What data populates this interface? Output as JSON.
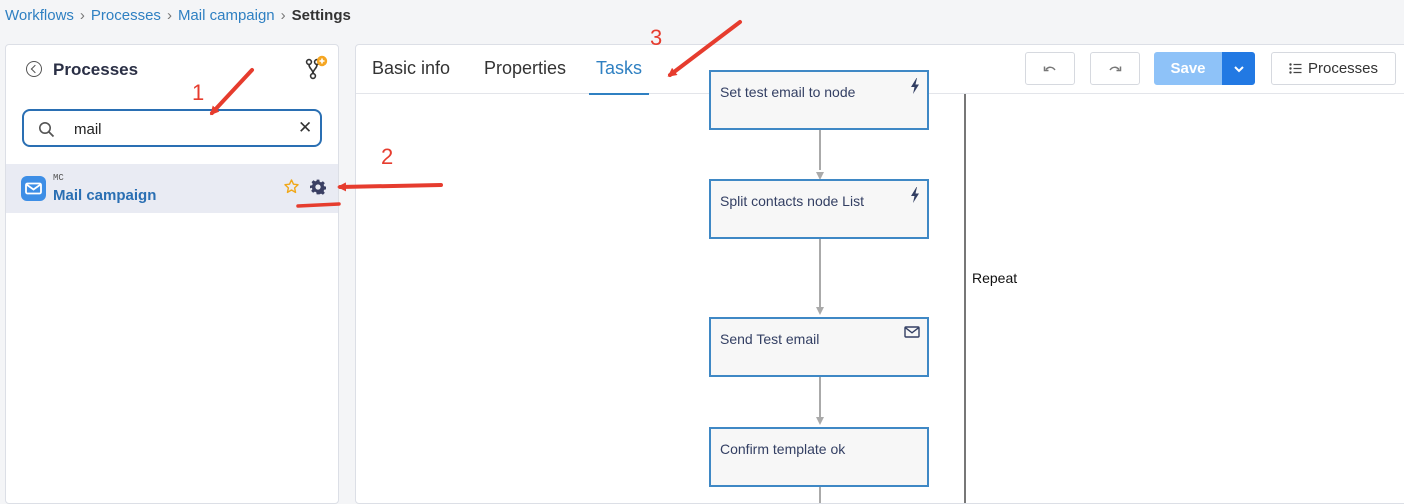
{
  "breadcrumb": {
    "item1": "Workflows",
    "item2": "Processes",
    "item3": "Mail campaign",
    "current": "Settings",
    "separator": "›"
  },
  "sidebar": {
    "title": "Processes",
    "search": {
      "value": "mail",
      "placeholder": ""
    },
    "items": [
      {
        "code": "MC",
        "name": "Mail campaign",
        "favorite": false
      }
    ]
  },
  "tabs": {
    "basic_info": "Basic info",
    "properties": "Properties",
    "tasks": "Tasks",
    "active": "Tasks"
  },
  "toolbar": {
    "save_label": "Save",
    "processes_label": "Processes"
  },
  "flow": {
    "nodes": {
      "n0": {
        "label": "Set test email to node",
        "icon": "lightning-icon"
      },
      "n1": {
        "label": "Split contacts node List",
        "icon": "lightning-icon"
      },
      "n2": {
        "label": "Send Test email",
        "icon": "envelope-icon"
      },
      "n3": {
        "label": "Confirm template ok",
        "icon": ""
      }
    },
    "loop_label": "Repeat"
  },
  "annotations": {
    "a1": "1",
    "a2": "2",
    "a3": "3"
  },
  "colors": {
    "accent": "#2f80c2",
    "annotation": "#e63c2e",
    "save_disabled": "#8ec2f8",
    "save_dropdown": "#2279e3",
    "mail_icon": "#3d8ee6",
    "star": "#f0a81a"
  }
}
